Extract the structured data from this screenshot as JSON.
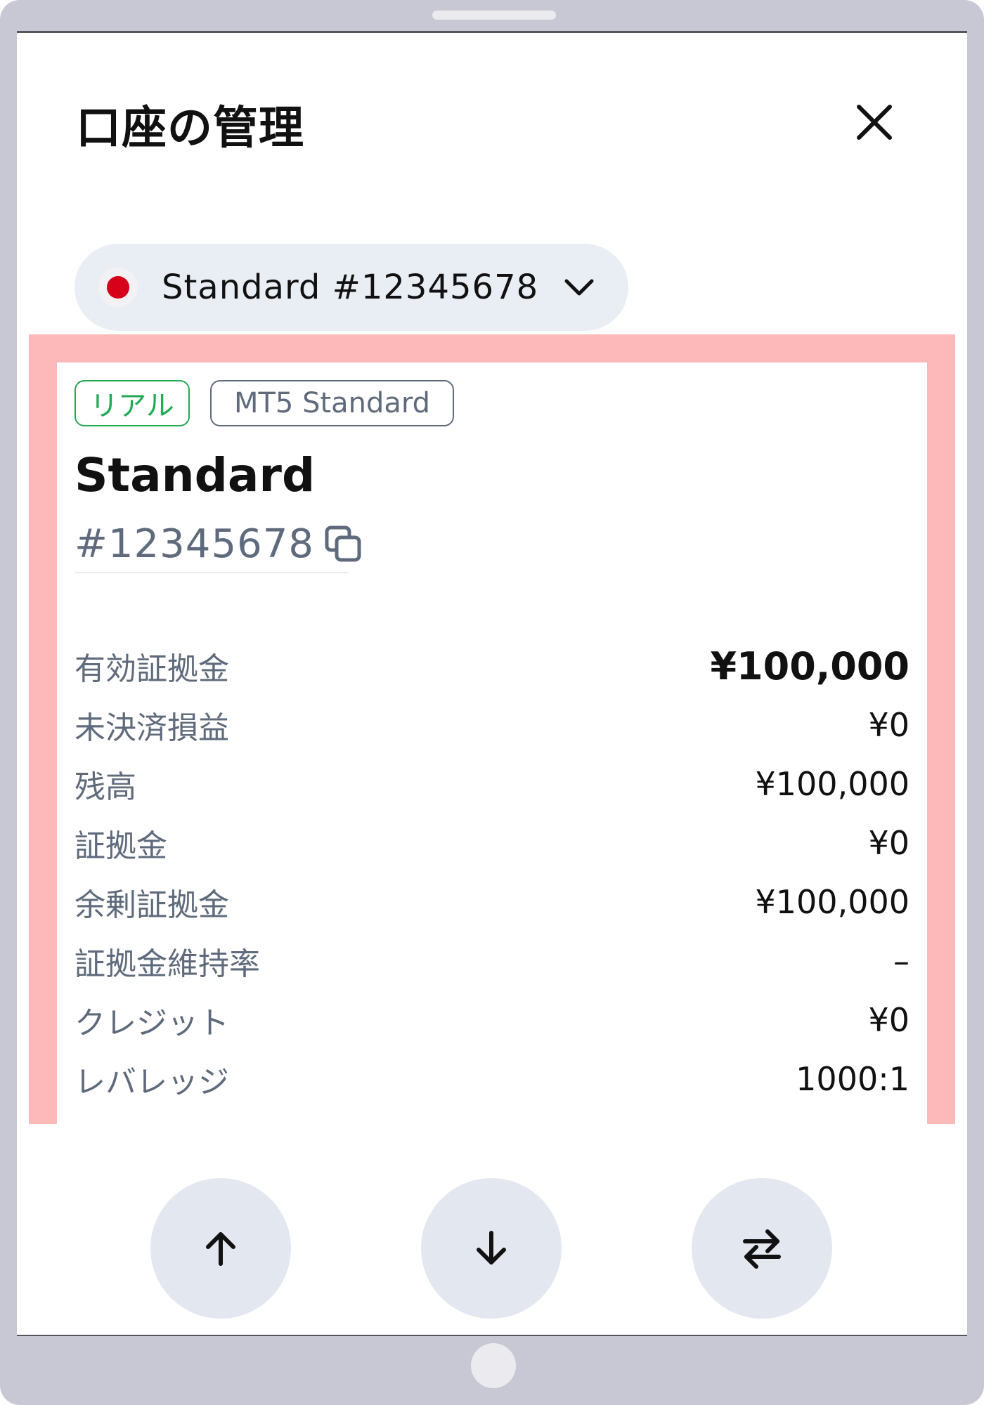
{
  "header": {
    "title": "口座の管理",
    "close_icon": "close-icon"
  },
  "account_selector": {
    "label": "Standard #12345678",
    "flag_color": "#d7001a",
    "chevron_icon": "chevron-down-icon"
  },
  "account_card": {
    "tags": {
      "real": "リアル",
      "platform": "MT5 Standard"
    },
    "name": "Standard",
    "number": "#12345678",
    "copy_icon": "copy-icon",
    "stats": [
      {
        "label": "有効証拠金",
        "value": "¥100,000"
      },
      {
        "label": "未決済損益",
        "value": "¥0"
      },
      {
        "label": "残高",
        "value": "¥100,000"
      },
      {
        "label": "証拠金",
        "value": "¥0"
      },
      {
        "label": "余剰証拠金",
        "value": "¥100,000"
      },
      {
        "label": "証拠金維持率",
        "value": "–"
      },
      {
        "label": "クレジット",
        "value": "¥0"
      },
      {
        "label": "レバレッジ",
        "value": "1000:1"
      }
    ]
  },
  "actions": {
    "deposit_icon": "arrow-up-icon",
    "withdraw_icon": "arrow-down-icon",
    "transfer_icon": "transfer-arrows-icon"
  },
  "colors": {
    "highlight": "#fdb9b9",
    "real_tag": "#22aa55",
    "muted_text": "#5f6b7c",
    "action_bg": "#e3e8f0",
    "selector_bg": "#e9eef5"
  }
}
